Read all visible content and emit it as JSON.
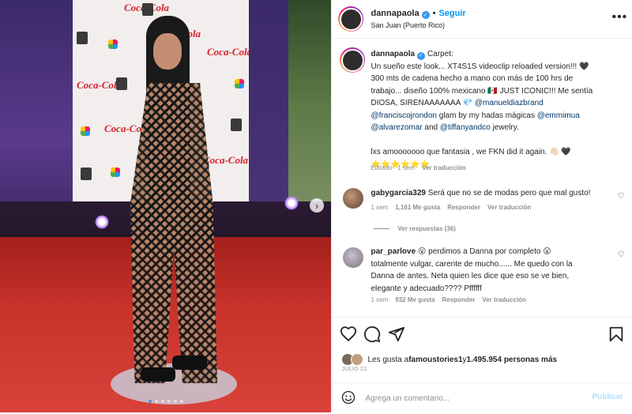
{
  "post": {
    "username": "dannapaola",
    "verified": true,
    "follow_label": "Seguir",
    "location": "San Juan (Puerto Rico)",
    "more_icon": "more-horizontal-icon",
    "photo": {
      "description_icon": "post-photo",
      "next_icon": "chevron-right-icon",
      "slide_count": 6,
      "active_slide": 1,
      "logos": [
        "Coca-Cola",
        "Coca-Cola",
        "Coca-Cola",
        "Coca-Cola",
        "Coca-Cola",
        "Coca-Cola",
        "Coca-Cola",
        "Coca-Cola"
      ]
    }
  },
  "caption": {
    "username": "dannapaola",
    "verified": true,
    "lines": [
      "Carpet:",
      "Un sueño este look... XT4S1S videoclip reloaded version!!! 🖤",
      "300 mts de cadena hecho a mano con más de 100 hrs de",
      "trabajo... diseño 100% mexicano 🇲🇽 JUST ICONIC!!! Me sentía",
      "DIOSA, SIRENAAAAAAA 💎"
    ],
    "mention1": "@manueldiazbrand",
    "mention2": "@franciscojrondon",
    "text_glam": " glam by my hadas mágicas ",
    "mention3": "@emmimua",
    "mention4": "@alvarezomar",
    "text_and": " and ",
    "mention5": "@tiffanyandco",
    "text_jewelry": " jewelry.",
    "line_final": "lxs amooooooo que fantasia , we FKN did it again. 👋🏻 🖤",
    "stars": "⭐⭐⭐⭐⭐⭐",
    "meta_edited": "Editado",
    "meta_time": "1 sem",
    "meta_translate": "Ver traducción"
  },
  "comments": [
    {
      "username": "gabygarcia329",
      "text": "Será que no se de modas pero que mal gusto!",
      "time": "1 sem",
      "likes": "1,161 Me gusta",
      "reply": "Responder",
      "translate": "Ver traducción",
      "view_replies": "Ver respuestas (36)"
    },
    {
      "username": "par_parlove",
      "text_lines": [
        "😮 perdimos a Danna por completo 😮",
        "totalmente vulgar, carente de mucho...... Me quedo con la",
        "Danna de antes. Neta quien les dice que eso se ve bien,",
        "elegante y adecuado???? Pffffff"
      ],
      "time": "1 sem",
      "likes": "932 Me gusta",
      "reply": "Responder",
      "translate": "Ver traducción"
    }
  ],
  "actions": {
    "icons": [
      "heart-icon",
      "comment-icon",
      "share-icon",
      "bookmark-icon"
    ],
    "likes_prefix": "Les gusta a ",
    "likes_user": "famoustories1",
    "likes_middle": " y ",
    "likes_count": "1.495.954 personas más",
    "date": "JULIO 21"
  },
  "composer": {
    "placeholder": "Agrega un comentario...",
    "publish_label": "Publicar",
    "emoji_icon": "emoji-icon"
  }
}
